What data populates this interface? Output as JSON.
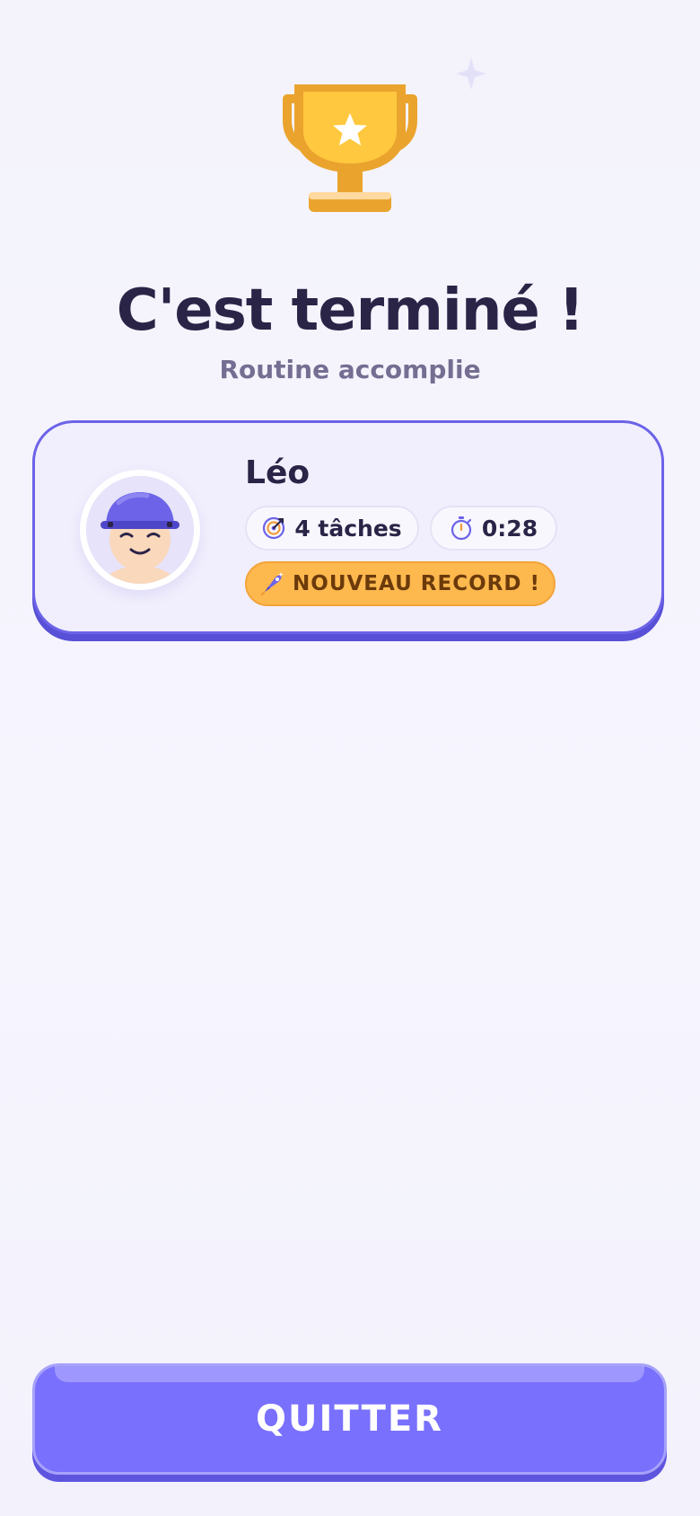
{
  "header": {
    "title": "C'est terminé !",
    "subtitle": "Routine accomplie"
  },
  "result_card": {
    "child_name": "Léo",
    "tasks_label": "4 tâches",
    "time_label": "0:28",
    "record_label": "NOUVEAU RECORD !"
  },
  "footer": {
    "quit_label": "QUITTER"
  },
  "icons": {
    "trophy": "trophy-icon",
    "sparkle": "sparkle-icon",
    "tasks": "target-icon",
    "time": "stopwatch-icon",
    "record": "rocket-icon"
  },
  "colors": {
    "accent": "#6C63E8",
    "button": "#7970FD",
    "record_badge": "#FDB84E",
    "title_text": "#2A2447",
    "trophy_gold": "#F4B73A"
  }
}
